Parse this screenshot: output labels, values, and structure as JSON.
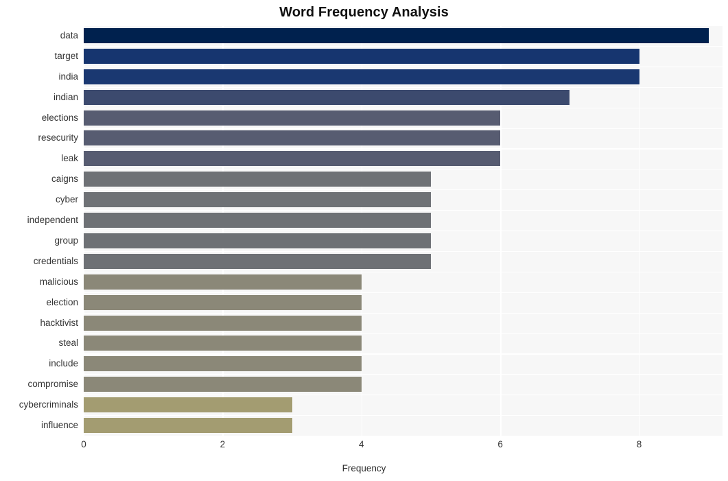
{
  "chart_data": {
    "type": "bar",
    "orientation": "horizontal",
    "title": "Word Frequency Analysis",
    "xlabel": "Frequency",
    "ylabel": "",
    "xlim": [
      0,
      9.2
    ],
    "xticks": [
      0,
      2,
      4,
      6,
      8
    ],
    "xtick_labels": [
      "0",
      "2",
      "4",
      "6",
      "8"
    ],
    "grid": true,
    "legend": "none",
    "categories": [
      "data",
      "target",
      "india",
      "indian",
      "elections",
      "resecurity",
      "leak",
      "caigns",
      "cyber",
      "independent",
      "group",
      "credentials",
      "malicious",
      "election",
      "hacktivist",
      "steal",
      "include",
      "compromise",
      "cybercriminals",
      "influence"
    ],
    "values": [
      9,
      8,
      8,
      7,
      6,
      6,
      6,
      5,
      5,
      5,
      5,
      5,
      4,
      4,
      4,
      4,
      4,
      4,
      3,
      3
    ],
    "bar_colors": [
      "#00214e",
      "#16356f",
      "#1a3871",
      "#3c4a6e",
      "#575c71",
      "#575c71",
      "#575c71",
      "#6e7175",
      "#6e7175",
      "#6e7175",
      "#6e7175",
      "#6e7175",
      "#8b8878",
      "#8b8878",
      "#8b8878",
      "#8b8878",
      "#8b8878",
      "#8b8878",
      "#a39c71",
      "#a39c71"
    ],
    "plot_background": "#f7f7f7",
    "grid_color": "#ffffff",
    "figure_background": "#ffffff"
  }
}
